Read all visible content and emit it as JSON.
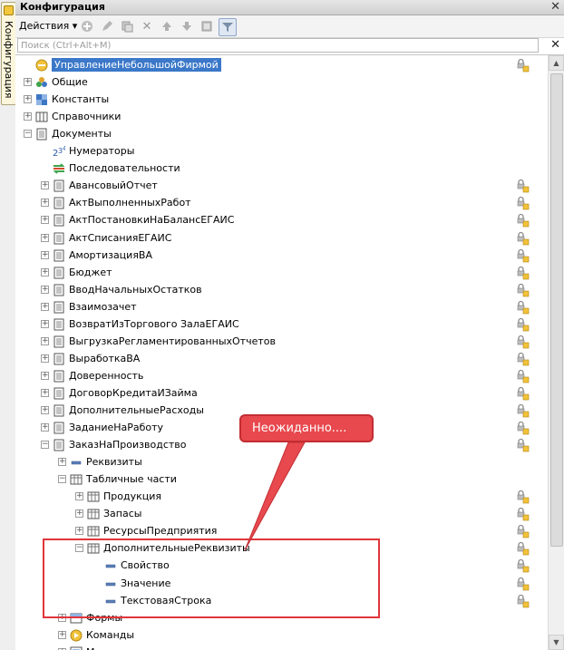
{
  "side_tab": {
    "label": "Конфигурация"
  },
  "window": {
    "title": "Конфигурация"
  },
  "toolbar": {
    "actions_label": "Действия ▾"
  },
  "search": {
    "placeholder": "Поиск (Ctrl+Alt+M)"
  },
  "tree": [
    {
      "label": "УправлениеНебольшойФирмой",
      "icon": "config-root-icon",
      "lock": true,
      "selected": true,
      "indent": 0,
      "exp": ""
    },
    {
      "label": "Общие",
      "icon": "common-icon",
      "indent": 0,
      "exp": "+"
    },
    {
      "label": "Константы",
      "icon": "constants-icon",
      "indent": 0,
      "exp": "+"
    },
    {
      "label": "Справочники",
      "icon": "catalogs-icon",
      "indent": 0,
      "exp": "+"
    },
    {
      "label": "Документы",
      "icon": "documents-icon",
      "indent": 0,
      "exp": "−"
    },
    {
      "label": "Нумераторы",
      "icon": "numerators-icon",
      "indent": 1,
      "exp": ""
    },
    {
      "label": "Последовательности",
      "icon": "sequences-icon",
      "indent": 1,
      "exp": ""
    },
    {
      "label": "АвансовыйОтчет",
      "icon": "document-icon",
      "lock": true,
      "indent": 1,
      "exp": "+"
    },
    {
      "label": "АктВыполненныхРабот",
      "icon": "document-icon",
      "lock": true,
      "indent": 1,
      "exp": "+"
    },
    {
      "label": "АктПостановкиНаБалансЕГАИС",
      "icon": "document-icon",
      "lock": true,
      "indent": 1,
      "exp": "+"
    },
    {
      "label": "АктСписанияЕГАИС",
      "icon": "document-icon",
      "lock": true,
      "indent": 1,
      "exp": "+"
    },
    {
      "label": "АмортизацияВА",
      "icon": "document-icon",
      "lock": true,
      "indent": 1,
      "exp": "+"
    },
    {
      "label": "Бюджет",
      "icon": "document-icon",
      "lock": true,
      "indent": 1,
      "exp": "+"
    },
    {
      "label": "ВводНачальныхОстатков",
      "icon": "document-icon",
      "lock": true,
      "indent": 1,
      "exp": "+"
    },
    {
      "label": "Взаимозачет",
      "icon": "document-icon",
      "lock": true,
      "indent": 1,
      "exp": "+"
    },
    {
      "label": "ВозвратИзТоргового ЗалаЕГАИС",
      "icon": "document-icon",
      "lock": true,
      "indent": 1,
      "exp": "+"
    },
    {
      "label": "ВыгрузкаРегламентированныхОтчетов",
      "icon": "document-icon",
      "lock": true,
      "indent": 1,
      "exp": "+"
    },
    {
      "label": "ВыработкаВА",
      "icon": "document-icon",
      "lock": true,
      "indent": 1,
      "exp": "+"
    },
    {
      "label": "Доверенность",
      "icon": "document-icon",
      "lock": true,
      "indent": 1,
      "exp": "+"
    },
    {
      "label": "ДоговорКредитаИЗайма",
      "icon": "document-icon",
      "lock": true,
      "indent": 1,
      "exp": "+"
    },
    {
      "label": "ДополнительныеРасходы",
      "icon": "document-icon",
      "lock": true,
      "indent": 1,
      "exp": "+"
    },
    {
      "label": "ЗаданиеНаРаботу",
      "icon": "document-icon",
      "lock": true,
      "indent": 1,
      "exp": "+"
    },
    {
      "label": "ЗаказНаПроизводство",
      "icon": "document-icon",
      "lock": true,
      "indent": 1,
      "exp": "−"
    },
    {
      "label": "Реквизиты",
      "icon": "attribute-icon",
      "indent": 2,
      "exp": "+"
    },
    {
      "label": "Табличные части",
      "icon": "tabular-icon",
      "indent": 2,
      "exp": "−"
    },
    {
      "label": "Продукция",
      "icon": "tabular-icon",
      "lock": true,
      "indent": 3,
      "exp": "+"
    },
    {
      "label": "Запасы",
      "icon": "tabular-icon",
      "lock": true,
      "indent": 3,
      "exp": "+"
    },
    {
      "label": "РесурсыПредприятия",
      "icon": "tabular-icon",
      "lock": true,
      "indent": 3,
      "exp": "+"
    },
    {
      "label": "ДополнительныеРеквизиты",
      "icon": "tabular-icon",
      "lock": true,
      "indent": 3,
      "exp": "−"
    },
    {
      "label": "Свойство",
      "icon": "attribute-icon",
      "lock": true,
      "indent": 4,
      "exp": ""
    },
    {
      "label": "Значение",
      "icon": "attribute-icon",
      "lock": true,
      "indent": 4,
      "exp": ""
    },
    {
      "label": "ТекстоваяСтрока",
      "icon": "attribute-icon",
      "lock": true,
      "indent": 4,
      "exp": ""
    },
    {
      "label": "Формы",
      "icon": "forms-icon",
      "indent": 2,
      "exp": "+"
    },
    {
      "label": "Команды",
      "icon": "commands-icon",
      "indent": 2,
      "exp": "+"
    },
    {
      "label": "Макеты",
      "icon": "templates-icon",
      "indent": 2,
      "exp": "+"
    }
  ],
  "callout": {
    "text": "Неожиданно...."
  },
  "colors": {
    "callout": "#e8494e",
    "highlight": "#e0363b",
    "selection": "#3b78c9"
  }
}
